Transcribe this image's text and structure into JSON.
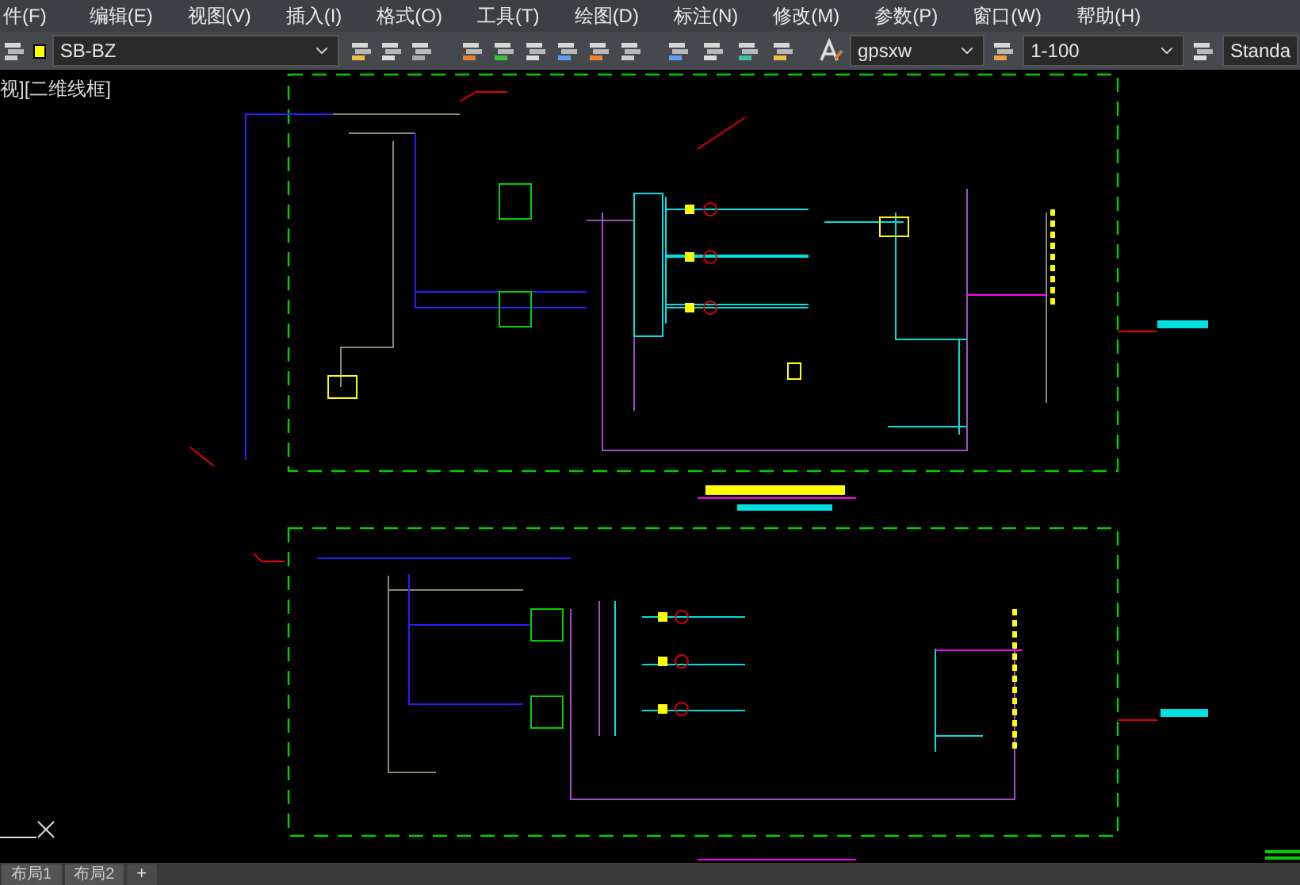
{
  "menu": [
    {
      "label": "件(F)"
    },
    {
      "label": "编辑(E)"
    },
    {
      "label": "视图(V)"
    },
    {
      "label": "插入(I)"
    },
    {
      "label": "格式(O)"
    },
    {
      "label": "工具(T)"
    },
    {
      "label": "绘图(D)"
    },
    {
      "label": "标注(N)"
    },
    {
      "label": "修改(M)"
    },
    {
      "label": "参数(P)"
    },
    {
      "label": "窗口(W)"
    },
    {
      "label": "帮助(H)"
    }
  ],
  "toolbar": {
    "layer": "SB-BZ",
    "text_style": "gpsxw",
    "dim_style": "1-100",
    "table_style": "Standa"
  },
  "viewport_label": "视][二维线框]",
  "layout_tabs": [
    {
      "label": "布局1",
      "selected": false
    },
    {
      "label": "布局2",
      "selected": false
    }
  ],
  "add_tab": "+"
}
